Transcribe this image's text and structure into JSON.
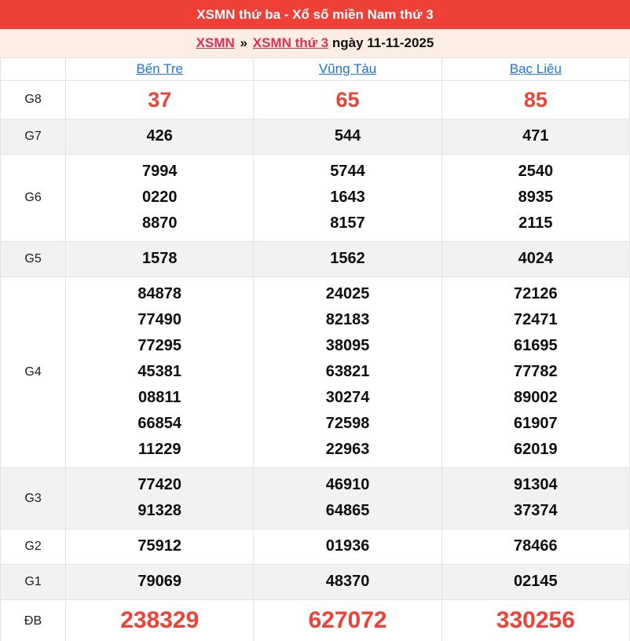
{
  "header": {
    "title": "XSMN thứ ba - Xổ số miền Nam thứ 3"
  },
  "breadcrumb": {
    "home_label": "XSMN",
    "separator": "»",
    "page_label": "XSMN thứ 3",
    "date_label": "ngày 11-11-2025"
  },
  "table": {
    "columns": [
      "Bến Tre",
      "Vũng Tàu",
      "Bạc Liêu"
    ],
    "rows": [
      {
        "label": "G8",
        "values": [
          [
            "37"
          ],
          [
            "65"
          ],
          [
            "85"
          ]
        ]
      },
      {
        "label": "G7",
        "values": [
          [
            "426"
          ],
          [
            "544"
          ],
          [
            "471"
          ]
        ]
      },
      {
        "label": "G6",
        "values": [
          [
            "7994",
            "0220",
            "8870"
          ],
          [
            "5744",
            "1643",
            "8157"
          ],
          [
            "2540",
            "8935",
            "2115"
          ]
        ]
      },
      {
        "label": "G5",
        "values": [
          [
            "1578"
          ],
          [
            "1562"
          ],
          [
            "4024"
          ]
        ]
      },
      {
        "label": "G4",
        "values": [
          [
            "84878",
            "77490",
            "77295",
            "45381",
            "08811",
            "66854",
            "11229"
          ],
          [
            "24025",
            "82183",
            "38095",
            "63821",
            "30274",
            "72598",
            "22963"
          ],
          [
            "72126",
            "72471",
            "61695",
            "77782",
            "89002",
            "61907",
            "62019"
          ]
        ]
      },
      {
        "label": "G3",
        "values": [
          [
            "77420",
            "91328"
          ],
          [
            "46910",
            "64865"
          ],
          [
            "91304",
            "37374"
          ]
        ]
      },
      {
        "label": "G2",
        "values": [
          [
            "75912"
          ],
          [
            "01936"
          ],
          [
            "78466"
          ]
        ]
      },
      {
        "label": "G1",
        "values": [
          [
            "79069"
          ],
          [
            "48370"
          ],
          [
            "02145"
          ]
        ]
      },
      {
        "label": "ĐB",
        "values": [
          [
            "238329"
          ],
          [
            "627072"
          ],
          [
            "330256"
          ]
        ]
      }
    ]
  },
  "colors": {
    "header_bg": "#ee4036",
    "breadcrumb_bg": "#fdeee3",
    "red_link": "#e22e56",
    "blue_link": "#1a73e8",
    "highlight_number": "#f04137",
    "shaded_row_bg": "#f2f2f2",
    "border": "#e3e3e3"
  }
}
